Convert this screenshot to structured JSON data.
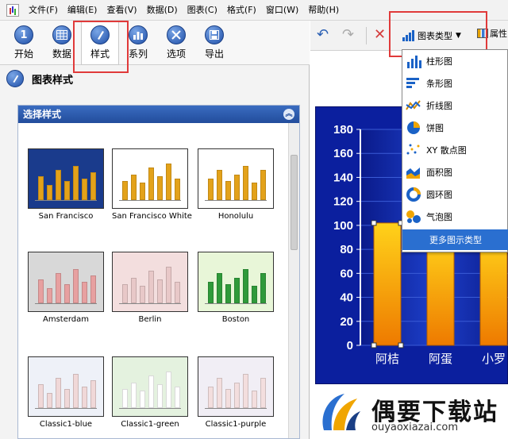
{
  "menubar": {
    "items": [
      "文件(F)",
      "编辑(E)",
      "查看(V)",
      "数据(D)",
      "图表(C)",
      "格式(F)",
      "窗口(W)",
      "帮助(H)"
    ]
  },
  "toolbar": {
    "buttons": [
      {
        "label": "开始",
        "icon": "1"
      },
      {
        "label": "数据",
        "icon": "table-icon"
      },
      {
        "label": "样式",
        "icon": "brush-icon"
      },
      {
        "label": "系列",
        "icon": "series-icon"
      },
      {
        "label": "选项",
        "icon": "tools-icon"
      },
      {
        "label": "导出",
        "icon": "disk-icon"
      }
    ],
    "active": "样式"
  },
  "section_title": "图表样式",
  "panel": {
    "title": "选择样式",
    "styles": [
      {
        "label": "San Francisco",
        "bg": "#1a3b8c",
        "bar": "#e3a21a",
        "kind": "bar"
      },
      {
        "label": "San Francisco White",
        "bg": "#ffffff",
        "bar": "#e3a21a",
        "kind": "bar"
      },
      {
        "label": "Honolulu",
        "bg": "#ffffff",
        "bar": "#e3a21a",
        "kind": "bar"
      },
      {
        "label": "Amsterdam",
        "bg": "#d8d8d8",
        "bar": "#e7a0a0",
        "kind": "bar"
      },
      {
        "label": "Berlin",
        "bg": "#f3dede",
        "bar": "#e8c8c8",
        "kind": "bar"
      },
      {
        "label": "Boston",
        "bg": "#e8f6d8",
        "bar": "#2f9a3a",
        "kind": "bar"
      },
      {
        "label": "Classic1-blue",
        "bg": "#eef1f8",
        "bar": "#f0d8d8",
        "kind": "bar"
      },
      {
        "label": "Classic1-green",
        "bg": "#e4f2df",
        "bar": "#ffffff",
        "kind": "bar"
      },
      {
        "label": "Classic1-purple",
        "bg": "#f1eef5",
        "bar": "#f3dede",
        "kind": "bar"
      }
    ]
  },
  "right_toolbar": {
    "chart_type_label": "图表类型",
    "attr_label": "属性"
  },
  "dropdown": {
    "items": [
      {
        "label": "柱形图",
        "icon": "column-chart-icon"
      },
      {
        "label": "条形图",
        "icon": "bar-chart-icon"
      },
      {
        "label": "折线图",
        "icon": "line-chart-icon"
      },
      {
        "label": "饼图",
        "icon": "pie-chart-icon"
      },
      {
        "label": "XY 散点图",
        "icon": "scatter-chart-icon"
      },
      {
        "label": "面积图",
        "icon": "area-chart-icon"
      },
      {
        "label": "圆环图",
        "icon": "doughnut-chart-icon"
      },
      {
        "label": "气泡图",
        "icon": "bubble-chart-icon"
      }
    ],
    "more_label": "更多图示类型"
  },
  "chart_data": {
    "type": "bar",
    "categories": [
      "阿桔",
      "阿蛋",
      "小罗"
    ],
    "values": [
      102,
      91,
      91
    ],
    "ylim": [
      0,
      180
    ],
    "y_ticks": [
      0,
      20,
      40,
      60,
      80,
      100,
      120,
      140,
      160,
      180
    ],
    "title": "",
    "xlabel": "",
    "ylabel": "",
    "grid": true,
    "colors": {
      "background": "#0b1f9e",
      "bar_top": "#ffd21a",
      "bar_bottom": "#ee7a00",
      "text": "#ffffff",
      "grid": "#3a5bd6"
    }
  },
  "watermark": {
    "title": "偶要下载站",
    "url": "ouyaoxiazai.com"
  },
  "colors": {
    "accent": "#2a6fd0",
    "highlight": "#e03a3a"
  }
}
